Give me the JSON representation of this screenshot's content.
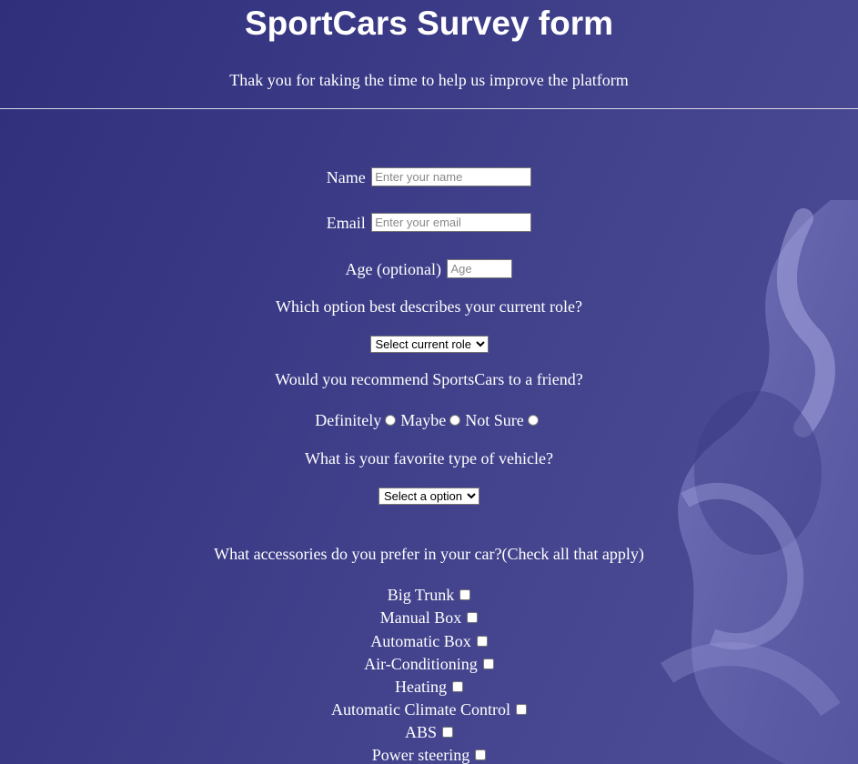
{
  "header": {
    "title": "SportCars Survey form",
    "subtitle": "Thak you for taking the time to help us improve the platform"
  },
  "form": {
    "name": {
      "label": "Name",
      "placeholder": "Enter your name",
      "value": ""
    },
    "email": {
      "label": "Email",
      "placeholder": "Enter your email",
      "value": ""
    },
    "age": {
      "label": "Age (optional)",
      "placeholder": "Age",
      "value": ""
    },
    "role": {
      "question": "Which option best describes your current role?",
      "selected": "Select current role"
    },
    "recommend": {
      "question": "Would you recommend SportsCars to a friend?",
      "options": [
        "Definitely",
        "Maybe",
        "Not Sure"
      ],
      "focused": "Definitely"
    },
    "vehicle": {
      "question": "What is your favorite type of vehicle?",
      "selected": "Select a option"
    },
    "accessories": {
      "question": "What accessories do you prefer in your car?(Check all that apply)",
      "items": [
        "Big Trunk",
        "Manual Box",
        "Automatic Box",
        "Air-Conditioning",
        "Heating",
        "Automatic Climate Control",
        "ABS",
        "Power steering"
      ]
    }
  },
  "colors": {
    "background_start": "#2f2f7c",
    "background_end": "#4d4d98",
    "text": "#ffffff",
    "decoration": "#8a8ad0"
  }
}
